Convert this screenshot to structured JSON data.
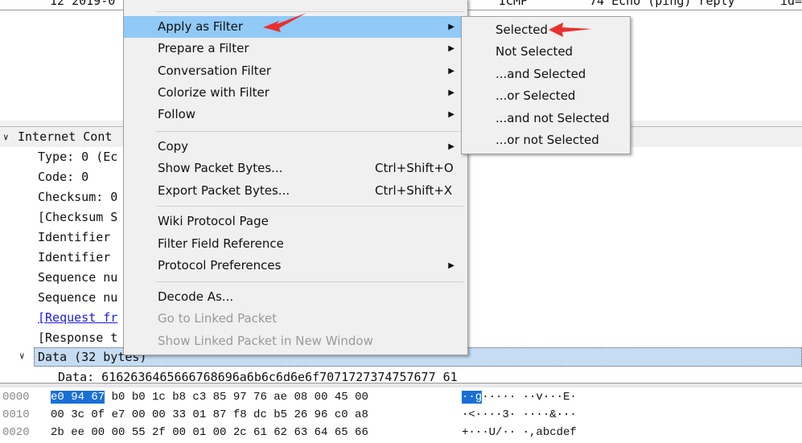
{
  "packet_list": {
    "row": {
      "no_time": "12 2019-0",
      "protocol": "ICMP",
      "info": "74 Echo (ping) reply",
      "extra": "id="
    }
  },
  "details": {
    "header": "Internet Cont",
    "fields": [
      "Type: 0 (Ec",
      "Code: 0",
      "Checksum: 0",
      "[Checksum S",
      "Identifier",
      "Identifier",
      "Sequence nu",
      "Sequence nu"
    ],
    "link": "[Request fr",
    "response": "[Response t",
    "data_node": "Data (32 bytes)",
    "data_value": "Data: 6162636465666768696a6b6c6d6e6f7071727374757677 61"
  },
  "hex": [
    {
      "offset": "0000",
      "sel": "e0 94 67",
      "bytes": " b0 b0 1c b8 c3  85 97 76 ae 08 00 45 00",
      "ascii_sel": "··g",
      "ascii": "·····  ··v···E·"
    },
    {
      "offset": "0010",
      "sel": "",
      "bytes": "00 3c 0f e7 00 00 33 01  87 f8 dc b5 26 96 c0 a8",
      "ascii_sel": "",
      "ascii": "·<····3·  ····&···"
    },
    {
      "offset": "0020",
      "sel": "",
      "bytes": "2b ee 00 00 55 2f 00 01  00 2c 61 62 63 64 65 66",
      "ascii_sel": "",
      "ascii": "+···U/··  ·,abcdef"
    }
  ],
  "context_menu": {
    "items": [
      {
        "label": "Apply as Filter",
        "submenu": true
      },
      {
        "label": "Prepare a Filter",
        "submenu": true
      },
      {
        "label": "Conversation Filter",
        "submenu": true
      },
      {
        "label": "Colorize with Filter",
        "submenu": true
      },
      {
        "label": "Follow",
        "submenu": true
      },
      {
        "label": "Copy",
        "submenu": true
      },
      {
        "label": "Show Packet Bytes...",
        "shortcut": "Ctrl+Shift+O"
      },
      {
        "label": "Export Packet Bytes...",
        "shortcut": "Ctrl+Shift+X"
      },
      {
        "label": "Wiki Protocol Page"
      },
      {
        "label": "Filter Field Reference"
      },
      {
        "label": "Protocol Preferences",
        "submenu": true
      },
      {
        "label": "Decode As..."
      },
      {
        "label": "Go to Linked Packet",
        "disabled": true
      },
      {
        "label": "Show Linked Packet in New Window",
        "disabled": true
      }
    ]
  },
  "submenu": {
    "items": [
      "Selected",
      "Not Selected",
      "...and Selected",
      "...or Selected",
      "...and not Selected",
      "...or not Selected"
    ]
  },
  "colors": {
    "highlight": "#91c9f7",
    "annotation_arrow": "#e8312f",
    "selection": "#1a6fd6"
  }
}
